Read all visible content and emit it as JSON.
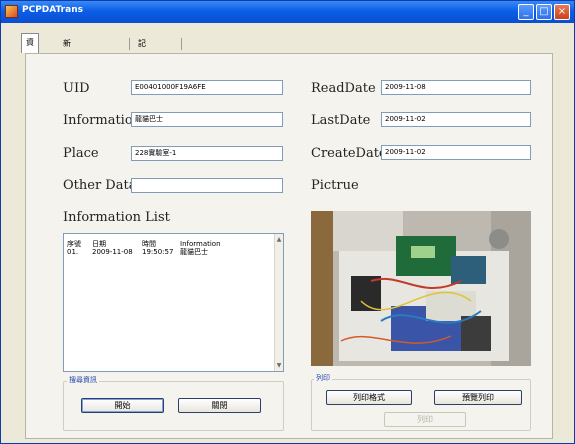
{
  "window": {
    "title": "PCPDATrans",
    "controls": {
      "minimize": "_",
      "maximize": "□",
      "close": "×"
    }
  },
  "tabs": [
    {
      "label": "資訊",
      "active": true
    },
    {
      "label": "新增/更新/刪除",
      "active": false
    },
    {
      "label": "記錄瀏覽",
      "active": false
    }
  ],
  "form": {
    "uid": {
      "label": "UID",
      "value": "E00401000F19A6FE"
    },
    "information": {
      "label": "Information",
      "value": "龍貓巴士"
    },
    "place": {
      "label": "Place",
      "value": "228實驗室-1"
    },
    "other_data": {
      "label": "Other Data",
      "value": ""
    },
    "read_date": {
      "label": "ReadDate",
      "value": "2009-11-08"
    },
    "last_date": {
      "label": "LastDate",
      "value": "2009-11-02"
    },
    "create_date": {
      "label": "CreateDate",
      "value": "2009-11-02"
    },
    "picture_label": "Pictrue"
  },
  "info_list": {
    "title": "Information List",
    "headers": [
      "序號",
      "日期",
      "時間",
      "Information"
    ],
    "rows": [
      [
        "01.",
        "2009-11-08",
        "19:50:57",
        "龍貓巴士"
      ]
    ]
  },
  "search_group": {
    "title": "搜尋資訊",
    "start_button": "開始",
    "close_button": "關閉"
  },
  "print_group": {
    "title": "列印",
    "format_button": "列印格式",
    "preview_button": "預覽列印",
    "print_button": "列印"
  }
}
